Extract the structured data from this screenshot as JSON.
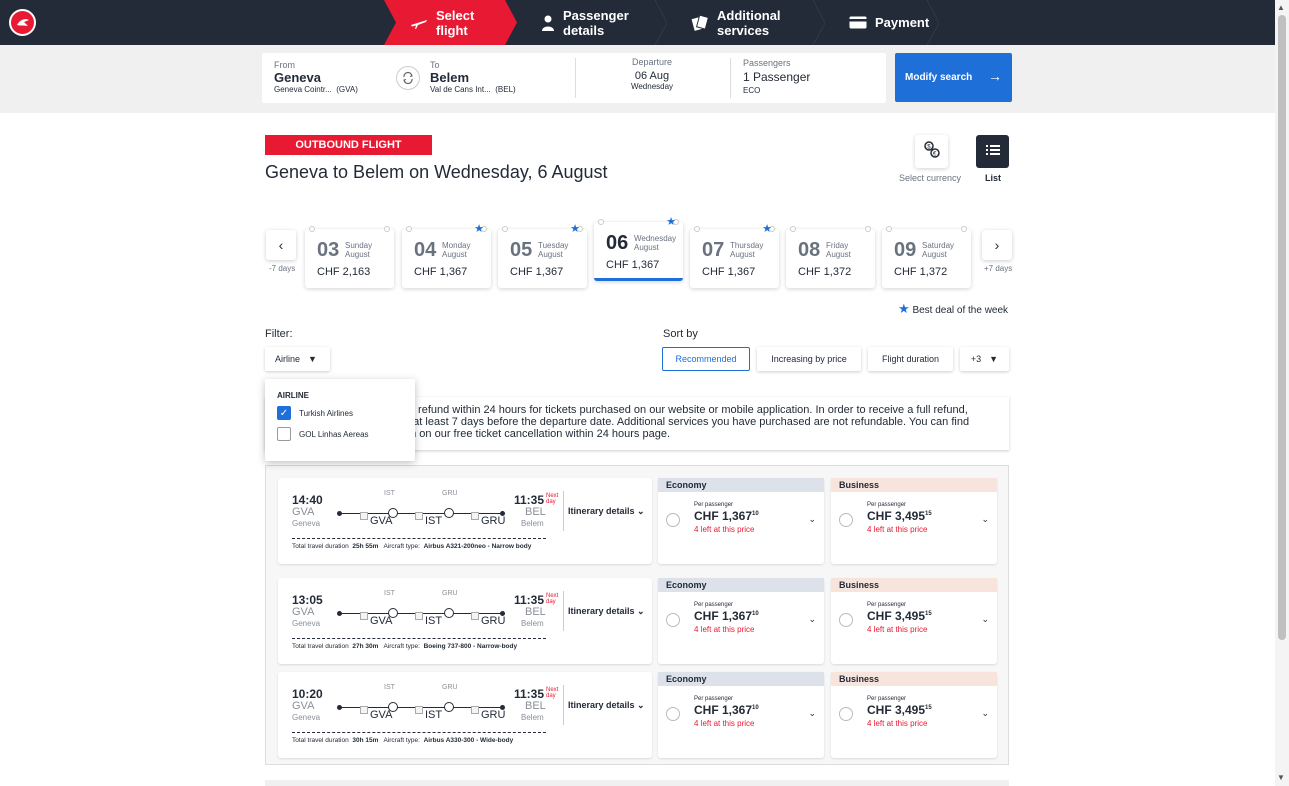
{
  "steps": [
    {
      "label": "Select flight"
    },
    {
      "label": "Passenger details"
    },
    {
      "label": "Additional services"
    },
    {
      "label": "Payment"
    }
  ],
  "search": {
    "from_label": "From",
    "from_city": "Geneva",
    "from_airport": "Geneva Cointr...",
    "from_code": "(GVA)",
    "to_label": "To",
    "to_city": "Belem",
    "to_airport": "Val de Cans Int...",
    "to_code": "(BEL)",
    "departure_label": "Departure",
    "departure_date": "06 Aug",
    "departure_day": "Wednesday",
    "passengers_label": "Passengers",
    "passengers_value": "1 Passenger",
    "cabin": "ECO",
    "modify_label": "Modify search"
  },
  "header": {
    "badge": "OUTBOUND FLIGHT",
    "title": "Geneva to Belem on Wednesday, 6 August",
    "currency_label": "Select currency",
    "list_label": "List"
  },
  "dates": {
    "prev_label": "-7 days",
    "next_label": "+7 days",
    "best_deal": "Best deal of the week",
    "days": [
      {
        "num": "03",
        "weekday": "Sunday",
        "month": "August",
        "price": "CHF 2,163",
        "best": false,
        "selected": false
      },
      {
        "num": "04",
        "weekday": "Monday",
        "month": "August",
        "price": "CHF 1,367",
        "best": true,
        "selected": false
      },
      {
        "num": "05",
        "weekday": "Tuesday",
        "month": "August",
        "price": "CHF 1,367",
        "best": true,
        "selected": false
      },
      {
        "num": "06",
        "weekday": "Wednesday",
        "month": "August",
        "price": "CHF 1,367",
        "best": true,
        "selected": true
      },
      {
        "num": "07",
        "weekday": "Thursday",
        "month": "August",
        "price": "CHF 1,367",
        "best": true,
        "selected": false
      },
      {
        "num": "08",
        "weekday": "Friday",
        "month": "August",
        "price": "CHF 1,372",
        "best": false,
        "selected": false
      },
      {
        "num": "09",
        "weekday": "Saturday",
        "month": "August",
        "price": "CHF 1,372",
        "best": false,
        "selected": false
      }
    ]
  },
  "filter": {
    "label": "Filter:",
    "airline_button": "Airline",
    "dropdown_heading": "AIRLINE",
    "options": [
      {
        "label": "Turkish Airlines",
        "checked": true
      },
      {
        "label": "GOL Linhas Aereas",
        "checked": false
      }
    ]
  },
  "sort": {
    "label": "Sort by",
    "options": [
      "Recommended",
      "Increasing by price",
      "Flight duration",
      "+3"
    ],
    "active": "Recommended"
  },
  "info_text": {
    "line1": "ull refund within 24 hours for tickets purchased on our website or mobile application. In order to receive a full refund,",
    "line2": "e at least 7 days before the departure date. Additional services you have purchased are not refundable. You can find",
    "line3": "on on our free ticket cancellation within 24 hours page."
  },
  "flights": [
    {
      "dep_time": "14:40",
      "dep_code": "GVA",
      "dep_city": "Geneva",
      "arr_time": "11:35",
      "arr_code": "BEL",
      "arr_city": "Belem",
      "next_day": "Next day",
      "stops": [
        "IST",
        "GRU"
      ],
      "airports": [
        "GVA",
        "IST",
        "GRU"
      ],
      "duration_label": "Total travel duration",
      "duration": "25h 55m",
      "aircraft_label": "Aircraft type:",
      "aircraft": "Airbus A321-200neo - Narrow body",
      "itinerary": "Itinerary details",
      "economy": {
        "label": "Economy",
        "per": "Per passenger",
        "price": "CHF 1,367",
        "cents": "10",
        "left": "4 left at this price"
      },
      "business": {
        "label": "Business",
        "per": "Per passenger",
        "price": "CHF 3,495",
        "cents": "15",
        "left": "4 left at this price"
      }
    },
    {
      "dep_time": "13:05",
      "dep_code": "GVA",
      "dep_city": "Geneva",
      "arr_time": "11:35",
      "arr_code": "BEL",
      "arr_city": "Belem",
      "next_day": "Next day",
      "stops": [
        "IST",
        "GRU"
      ],
      "airports": [
        "GVA",
        "IST",
        "GRU"
      ],
      "duration_label": "Total travel duration",
      "duration": "27h 30m",
      "aircraft_label": "Aircraft type:",
      "aircraft": "Boeing 737-800 - Narrow-body",
      "itinerary": "Itinerary details",
      "economy": {
        "label": "Economy",
        "per": "Per passenger",
        "price": "CHF 1,367",
        "cents": "10",
        "left": "4 left at this price"
      },
      "business": {
        "label": "Business",
        "per": "Per passenger",
        "price": "CHF 3,495",
        "cents": "15",
        "left": "4 left at this price"
      }
    },
    {
      "dep_time": "10:20",
      "dep_code": "GVA",
      "dep_city": "Geneva",
      "arr_time": "11:35",
      "arr_code": "BEL",
      "arr_city": "Belem",
      "next_day": "Next day",
      "stops": [
        "IST",
        "GRU"
      ],
      "airports": [
        "GVA",
        "IST",
        "GRU"
      ],
      "duration_label": "Total travel duration",
      "duration": "30h 15m",
      "aircraft_label": "Aircraft type:",
      "aircraft": "Airbus A330-300 - Wide-body",
      "itinerary": "Itinerary details",
      "economy": {
        "label": "Economy",
        "per": "Per passenger",
        "price": "CHF 1,367",
        "cents": "10",
        "left": "4 left at this price"
      },
      "business": {
        "label": "Business",
        "per": "Per passenger",
        "price": "CHF 3,495",
        "cents": "15",
        "left": "4 left at this price"
      }
    }
  ],
  "colors": {
    "brand_red": "#e81932",
    "navy": "#232b38",
    "accent_blue": "#1f6fd9"
  },
  "icons": [
    "turkish-airlines-logo",
    "plane-icon",
    "person-icon",
    "tickets-icon",
    "card-icon",
    "swap-icon",
    "arrow-right-icon",
    "currency-icon",
    "list-icon",
    "chevron-left-icon",
    "chevron-right-icon",
    "star-icon",
    "caret-down-icon",
    "check-icon",
    "chevron-down-icon"
  ]
}
